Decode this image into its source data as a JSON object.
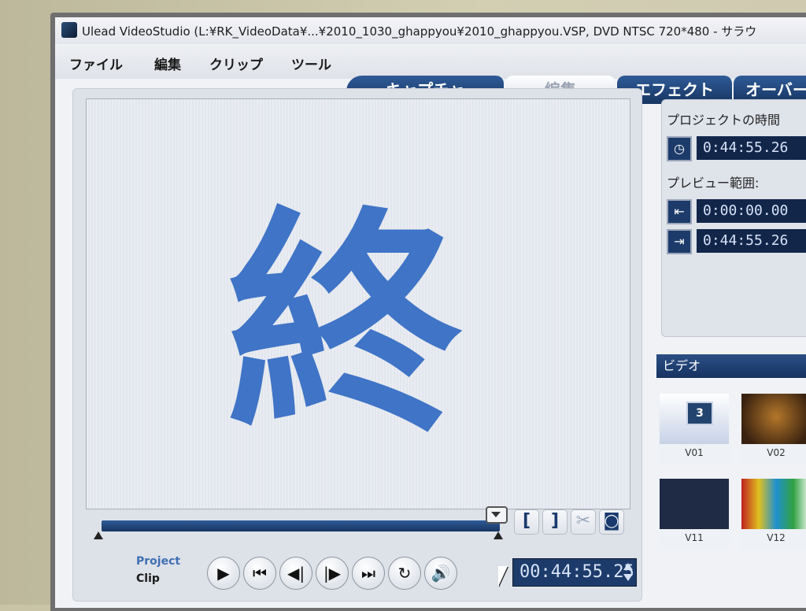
{
  "window": {
    "title": "Ulead VideoStudio (L:¥RK_VideoData¥...¥2010_1030_ghappyou¥2010_ghappyou.VSP, DVD NTSC 720*480 - サラウ"
  },
  "menu": {
    "items": [
      "ファイル",
      "編集",
      "クリップ",
      "ツール"
    ]
  },
  "tabs": {
    "items": [
      "キャプチャ",
      "編集",
      "エフェクト",
      "オーバー"
    ],
    "active": "編集"
  },
  "preview": {
    "text": "終",
    "text_color": "#3f74c6",
    "controls": {
      "mark_in": "[",
      "mark_out": "]",
      "project_label": "Project",
      "clip_label": "Clip",
      "timecode": "00:44:55.25"
    }
  },
  "side_panel": {
    "project_time_label": "プロジェクトの時間",
    "project_time": "0:44:55.26",
    "preview_range_label": "プレビュー範囲:",
    "range_start": "0:00:00.00",
    "range_end": "0:44:55.26"
  },
  "library": {
    "header": "ビデオ",
    "thumbs": [
      {
        "label": "V01",
        "screen_text": "3"
      },
      {
        "label": "V02"
      },
      {
        "label": "V11"
      },
      {
        "label": "V12"
      }
    ]
  },
  "icons": {
    "play": "play-icon",
    "home": "go-start-icon",
    "prev_frame": "prev-frame-icon",
    "next_frame": "next-frame-icon",
    "end": "go-end-icon",
    "repeat": "repeat-icon",
    "volume": "volume-icon",
    "cut": "scissors-icon",
    "snapshot": "snapshot-icon",
    "project_time_icon": "clock-icon",
    "range_start_icon": "range-start-icon",
    "range_end_icon": "range-end-icon"
  }
}
